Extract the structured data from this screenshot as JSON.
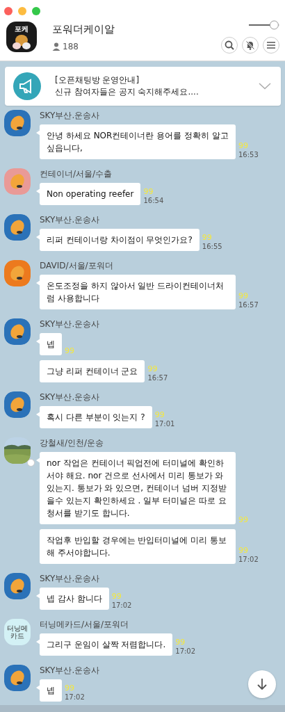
{
  "window": {
    "title": "포워더케이알",
    "member_count": "188",
    "avatar_text": "포케",
    "notifications_muted": true,
    "slider": {
      "level": 0.95
    }
  },
  "notice": {
    "title": "[오픈채팅방 운영안내]",
    "text": "신규 참여자들은 공지 숙지해주세요...."
  },
  "groups": [
    {
      "sender": "SKY부산.운송사",
      "avatar": {
        "kind": "character",
        "color": "#2b72b8"
      },
      "messages": [
        {
          "text": "안녕 하세요 NOR컨테이너란 용어를 정확히 알고 싶읍니다,",
          "unread": "99",
          "time": "16:53"
        }
      ]
    },
    {
      "sender": "컨테이너/서울/수출",
      "avatar": {
        "kind": "character",
        "color": "#e99a97"
      },
      "messages": [
        {
          "text": "Non operating reefer",
          "unread": "99",
          "time": "16:54"
        }
      ]
    },
    {
      "sender": "SKY부산.운송사",
      "avatar": {
        "kind": "character",
        "color": "#2b72b8"
      },
      "messages": [
        {
          "text": "리퍼 컨테이너랑 차이점이 무엇인가요?",
          "unread": "99",
          "time": "16:55"
        }
      ]
    },
    {
      "sender": "DAVID/서울/포워더",
      "avatar": {
        "kind": "character",
        "color": "#ec7a1e"
      },
      "messages": [
        {
          "text": "온도조정을 하지 않아서 일반 드라이컨테이너처럼 사용합니다",
          "unread": "99",
          "time": "16:57"
        }
      ]
    },
    {
      "sender": "SKY부산.운송사",
      "avatar": {
        "kind": "character",
        "color": "#2b72b8"
      },
      "messages": [
        {
          "text": "넵",
          "unread": "99"
        },
        {
          "text": "그냥 리퍼 컨테이너 군요",
          "unread": "99",
          "time": "16:57"
        }
      ]
    },
    {
      "sender": "SKY부산.운송사",
      "avatar": {
        "kind": "character",
        "color": "#2b72b8"
      },
      "messages": [
        {
          "text": "혹시 다른 부분이 잇는지 ?",
          "unread": "99",
          "time": "17:01"
        }
      ]
    },
    {
      "sender": "강철새/인천/운송",
      "avatar": {
        "kind": "picture",
        "badge": true
      },
      "messages": [
        {
          "text": "nor 작업은 컨테이너 픽업전에 터미널에 확인하서야 해요. nor 건으로 선사에서 미리 통보가 와있는지. 통보가 와 있으면, 컨테이너 넘버 지정받을수 있는지 확인하세요 . 일부 터미널은 따로 요청서를 받기도 합니다.",
          "unread": "99"
        },
        {
          "text": "작업후 반입할 경우에는 반입터미널에 미리 통보해 주서야합니다.",
          "unread": "99",
          "time": "17:02"
        }
      ]
    },
    {
      "sender": "SKY부산.운송사",
      "avatar": {
        "kind": "character",
        "color": "#2b72b8"
      },
      "messages": [
        {
          "text": "넵 감사 함니다",
          "unread": "99",
          "time": "17:02"
        }
      ]
    },
    {
      "sender": "터닝메카드/서울/포워더",
      "avatar": {
        "kind": "text",
        "color": "#d3f1f5",
        "text": "터닝메카드"
      },
      "messages": [
        {
          "text": "그리구 운임이 살짝 저렴합니다.",
          "unread": "99",
          "time": "17:02"
        }
      ]
    },
    {
      "sender": "SKY부산.운송사",
      "avatar": {
        "kind": "character",
        "color": "#2b72b8"
      },
      "messages": [
        {
          "text": "넵",
          "unread": "99",
          "time": "17:02"
        }
      ]
    }
  ]
}
